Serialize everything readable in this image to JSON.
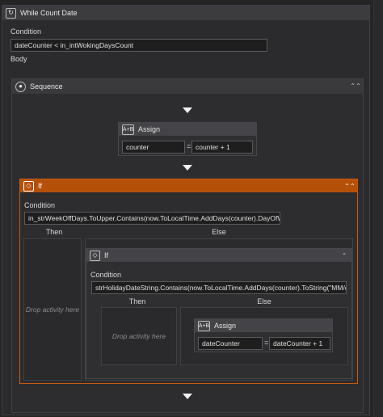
{
  "while": {
    "title": "While Count Date",
    "condition_label": "Condition",
    "condition_value": "dateCounter < in_intWokingDaysCount",
    "body_label": "Body"
  },
  "sequence": {
    "title": "Sequence"
  },
  "assign1": {
    "title": "Assign",
    "to": "counter",
    "equals": "=",
    "value": "counter + 1"
  },
  "if1": {
    "title": "If",
    "condition_label": "Condition",
    "condition_value": "in_strWeekOffDays.ToUpper.Contains(now.ToLocalTime.AddDays(counter).DayOfWe",
    "then_label": "Then",
    "else_label": "Else",
    "drop_text": "Drop activity here"
  },
  "if2": {
    "title": "If",
    "condition_label": "Condition",
    "condition_value": "strHolidayDateString.Contains(now.ToLocalTime.AddDays(counter).ToString(\"MM/d",
    "then_label": "Then",
    "else_label": "Else",
    "drop_text": "Drop activity here"
  },
  "assign2": {
    "title": "Assign",
    "to": "dateCounter",
    "equals": "=",
    "value": "dateCounter + 1"
  },
  "colors": {
    "selected_border": "#c85a0c",
    "selected_header": "#b4500a",
    "background": "#252526"
  }
}
